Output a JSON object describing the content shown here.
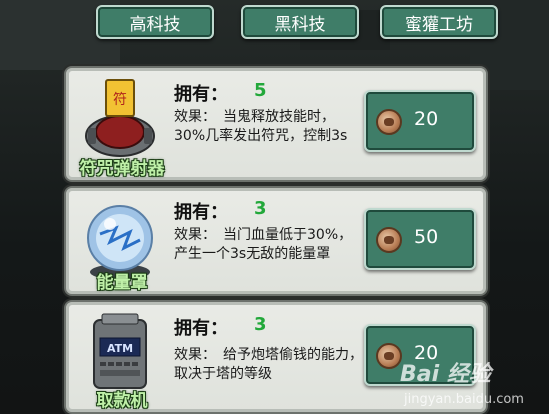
{
  "tabs": [
    {
      "label": "高科技"
    },
    {
      "label": "黑科技"
    },
    {
      "label": "蜜獾工坊"
    }
  ],
  "items": [
    {
      "name": "符咒弹射器",
      "own_label": "拥有：",
      "own_count": "5",
      "effect": "效果：　当鬼释放技能时，30%几率发出符咒，控制3s",
      "price": "20",
      "icon": "talisman-launcher-icon"
    },
    {
      "name": "能量罩",
      "own_label": "拥有：",
      "own_count": "3",
      "effect": "效果：　当门血量低于30%，产生一个3s无敌的能量罩",
      "price": "50",
      "icon": "energy-shield-icon"
    },
    {
      "name": "取款机",
      "own_label": "拥有：",
      "own_count": "3",
      "effect": "效果：　给予炮塔偷钱的能力，取决于塔的等级",
      "price": "20",
      "icon": "atm-icon"
    }
  ],
  "atm_screen_text": "ATM",
  "talisman_glyph": "符",
  "watermark": {
    "logo": "Bai 经验",
    "url": "jingyan.baidu.com"
  },
  "colors": {
    "tab": "#3f7d68",
    "count": "#22a83a",
    "name": "#bff0a8"
  }
}
